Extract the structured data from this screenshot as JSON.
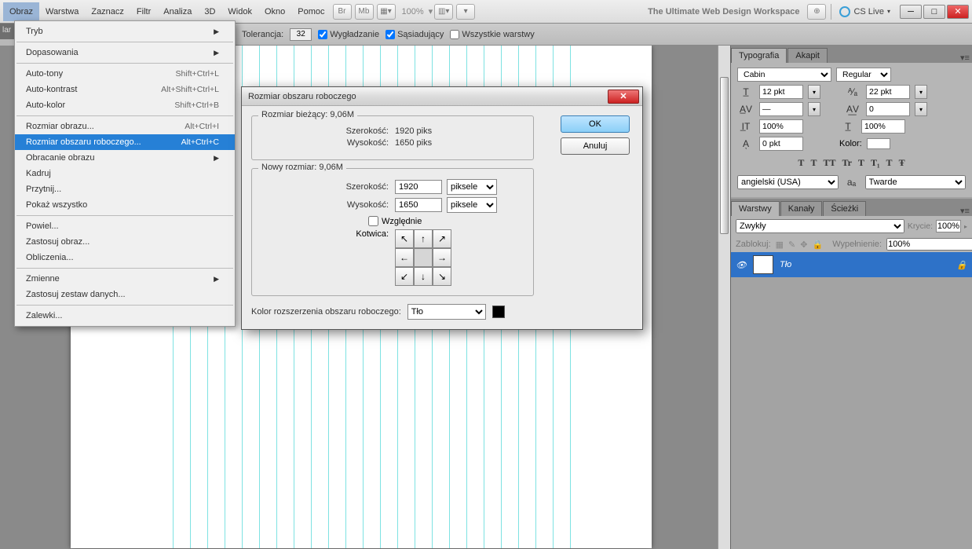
{
  "menubar": {
    "items": [
      "Obraz",
      "Warstwa",
      "Zaznacz",
      "Filtr",
      "Analiza",
      "3D",
      "Widok",
      "Okno",
      "Pomoc"
    ],
    "active_index": 0,
    "zoom": "100%",
    "workspace_label": "The Ultimate Web Design Workspace",
    "cs_live": "CS Live",
    "btn_br": "Br",
    "btn_mb": "Mb"
  },
  "options_bar": {
    "tolerance_label": "Tolerancja:",
    "tolerance_value": "32",
    "antialias": "Wygładzanie",
    "contiguous": "Sąsiadujący",
    "all_layers": "Wszystkie warstwy"
  },
  "dropdown": [
    {
      "label": "Tryb",
      "sub": true
    },
    {
      "sep": true
    },
    {
      "label": "Dopasowania",
      "sub": true
    },
    {
      "sep": true
    },
    {
      "label": "Auto-tony",
      "shortcut": "Shift+Ctrl+L"
    },
    {
      "label": "Auto-kontrast",
      "shortcut": "Alt+Shift+Ctrl+L"
    },
    {
      "label": "Auto-kolor",
      "shortcut": "Shift+Ctrl+B"
    },
    {
      "sep": true
    },
    {
      "label": "Rozmiar obrazu...",
      "shortcut": "Alt+Ctrl+I"
    },
    {
      "label": "Rozmiar obszaru roboczego...",
      "shortcut": "Alt+Ctrl+C",
      "hl": true
    },
    {
      "label": "Obracanie obrazu",
      "sub": true
    },
    {
      "label": "Kadruj"
    },
    {
      "label": "Przytnij..."
    },
    {
      "label": "Pokaż wszystko"
    },
    {
      "sep": true
    },
    {
      "label": "Powiel..."
    },
    {
      "label": "Zastosuj obraz..."
    },
    {
      "label": "Obliczenia..."
    },
    {
      "sep": true
    },
    {
      "label": "Zmienne",
      "sub": true
    },
    {
      "label": "Zastosuj zestaw danych..."
    },
    {
      "sep": true
    },
    {
      "label": "Zalewki..."
    }
  ],
  "dialog": {
    "title": "Rozmiar obszaru roboczego",
    "current_legend": "Rozmiar bieżący:  9,06M",
    "cur_w_label": "Szerokość:",
    "cur_w_val": "1920 piks",
    "cur_h_label": "Wysokość:",
    "cur_h_val": "1650 piks",
    "new_legend": "Nowy rozmiar: 9,06M",
    "new_w_label": "Szerokość:",
    "new_w_val": "1920",
    "new_h_label": "Wysokość:",
    "new_h_val": "1650",
    "unit": "piksele",
    "relative": "Względnie",
    "anchor_label": "Kotwica:",
    "ext_label": "Kolor rozszerzenia obszaru roboczego:",
    "ext_val": "Tło",
    "ok": "OK",
    "cancel": "Anuluj"
  },
  "typography": {
    "tab1": "Typografia",
    "tab2": "Akapit",
    "font_family": "Cabin",
    "font_style": "Regular",
    "font_size": "12 pkt",
    "leading": "22 pkt",
    "tracking": "0",
    "h_scale": "100%",
    "v_scale": "100%",
    "baseline": "0 pkt",
    "color_label": "Kolor:",
    "lang": "angielski (USA)",
    "aa": "Twarde",
    "aa_icon": "aₐ",
    "formats": [
      "T",
      "T",
      "TT",
      "Tr",
      "T",
      "T₁",
      "T",
      "Ŧ"
    ]
  },
  "layers": {
    "tab1": "Warstwy",
    "tab2": "Kanały",
    "tab3": "Ścieżki",
    "blend": "Zwykły",
    "opacity_label": "Krycie:",
    "opacity": "100%",
    "lock_label": "Zablokuj:",
    "fill_label": "Wypełnienie:",
    "fill": "100%",
    "layer_name": "Tło"
  },
  "tabstrip": "lar"
}
